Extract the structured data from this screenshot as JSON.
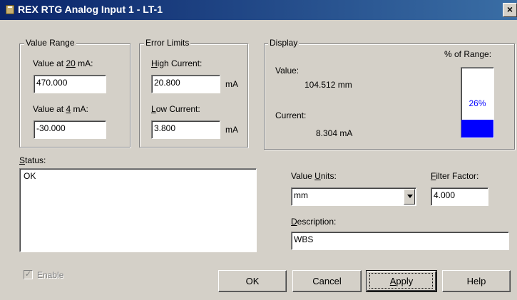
{
  "window": {
    "title": "REX RTG Analog Input 1 - LT-1",
    "close_glyph": "×"
  },
  "value_range": {
    "legend": "Value Range",
    "at20_label": {
      "pre": "Value at ",
      "ul": "20",
      "post": " mA:"
    },
    "at20_value": "470.000",
    "at4_label": {
      "pre": "Value at ",
      "ul": "4",
      "post": " mA:"
    },
    "at4_value": "-30.000"
  },
  "error_limits": {
    "legend": "Error Limits",
    "high_label": {
      "ul": "H",
      "post": "igh Current:"
    },
    "high_value": "20.800",
    "high_unit": "mA",
    "low_label": {
      "ul": "L",
      "post": "ow Current:"
    },
    "low_value": "3.800",
    "low_unit": "mA"
  },
  "display": {
    "legend": "Display",
    "value_label": "Value:",
    "value_reading": "104.512  mm",
    "current_label": "Current:",
    "current_reading": "8.304  mA",
    "range_label": "% of Range:",
    "range_percent_text": "26%",
    "range_fraction": 0.26,
    "bar_color": "#0000ff",
    "percent_text_color": "#0000ff"
  },
  "status": {
    "label_ul": "S",
    "label_post": "tatus:",
    "text": "OK"
  },
  "units": {
    "label_pre": "Value ",
    "label_ul": "U",
    "label_post": "nits:",
    "selected": "mm"
  },
  "filter": {
    "label_ul": "F",
    "label_post": "ilter Factor:",
    "value": "4.000"
  },
  "description": {
    "label_ul": "D",
    "label_post": "escription:",
    "value": "WBS"
  },
  "enable": {
    "label": "Enable",
    "checked": true,
    "check_glyph": "✓"
  },
  "buttons": {
    "ok": "OK",
    "cancel": "Cancel",
    "apply_ul": "A",
    "apply_post": "pply",
    "help": "Help"
  }
}
